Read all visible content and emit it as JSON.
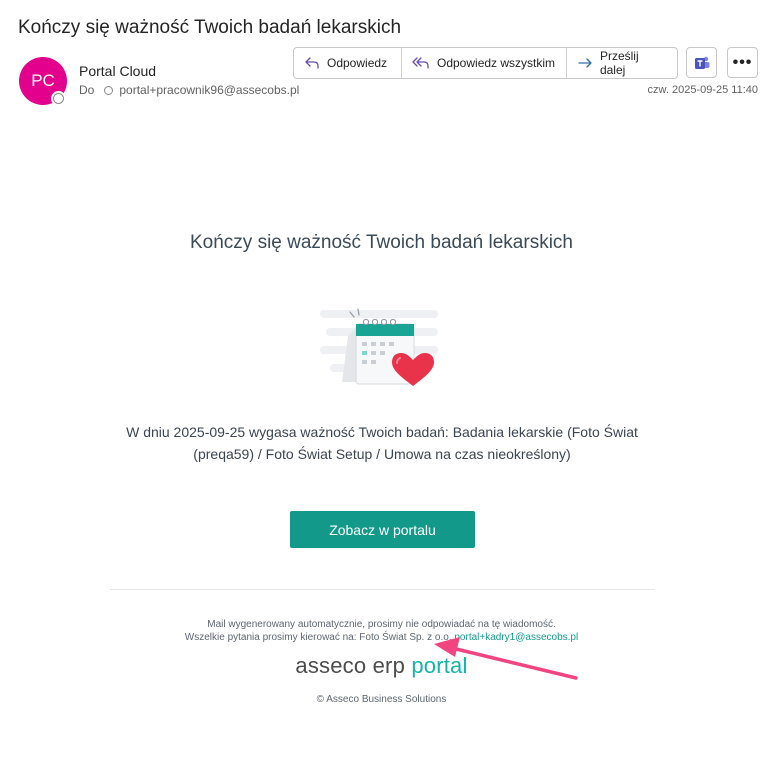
{
  "email": {
    "subject": "Kończy się ważność Twoich badań lekarskich",
    "avatar_initials": "PC",
    "sender_name": "Portal Cloud",
    "to_label": "Do",
    "recipient": "portal+pracownik96@assecobs.pl",
    "date": "czw. 2025-09-25 11:40"
  },
  "toolbar": {
    "reply_label": "Odpowiedz",
    "reply_all_label": "Odpowiedz wszystkim",
    "forward_label": "Prześlij dalej",
    "more_label": "•••"
  },
  "content": {
    "headline": "Kończy się ważność Twoich badań lekarskich",
    "body_line1": "W dniu 2025-09-25 wygasa ważność Twoich badań: Badania lekarskie (Foto Świat",
    "body_line2": "(preqa59) / Foto Świat Setup / Umowa na czas nieokreślony)",
    "cta_label": "Zobacz w portalu"
  },
  "footer": {
    "notice": "Mail wygenerowany automatycznie, prosimy nie odpowiadać na tę wiadomość.",
    "contact_text": "Wszelkie pytania prosimy kierować na: Foto Świat Sp. z o.o.",
    "contact_email": "portal+kadry1@assecobs.pl",
    "brand_part1": "asseco erp",
    "brand_part2": "portal",
    "copyright": "© Asseco Business Solutions"
  },
  "colors": {
    "avatar": "#e3008c",
    "accent": "#13998a",
    "annotation_arrow": "#f0457e"
  },
  "icons": [
    "reply-icon",
    "reply-all-icon",
    "forward-icon",
    "teams-icon",
    "calendar-heart-icon",
    "annotation-arrow"
  ]
}
